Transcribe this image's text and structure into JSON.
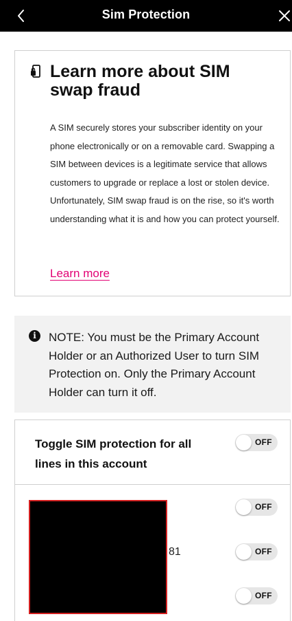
{
  "header": {
    "title": "Sim Protection",
    "back_icon": "chevron-left-icon",
    "close_icon": "close-icon"
  },
  "info_card": {
    "icon": "phone-lock-icon",
    "heading": "Learn more about SIM swap fraud",
    "body": "A SIM securely stores your subscriber identity on your phone electronically or on a removable card. Swapping a SIM between devices is a legitimate service that allows customers to upgrade or replace a lost or stolen device. Unfortunately, SIM swap fraud is on the rise, so it's worth understanding what it is and how you can protect yourself.",
    "link_label": "Learn more",
    "link_color": "#e20074"
  },
  "note": {
    "icon": "info-icon",
    "text": "NOTE: You must be the Primary Account Holder or an Authorized User to turn SIM Protection on. Only the Primary Account Holder can turn it off."
  },
  "toggles": {
    "all_lines_label": "Toggle SIM protection for all lines in this account",
    "all_lines_state": "OFF",
    "lines": [
      {
        "number_suffix": "",
        "state": "OFF"
      },
      {
        "number_suffix": "81",
        "state": "OFF"
      },
      {
        "number_suffix": "",
        "state": "OFF"
      }
    ]
  }
}
